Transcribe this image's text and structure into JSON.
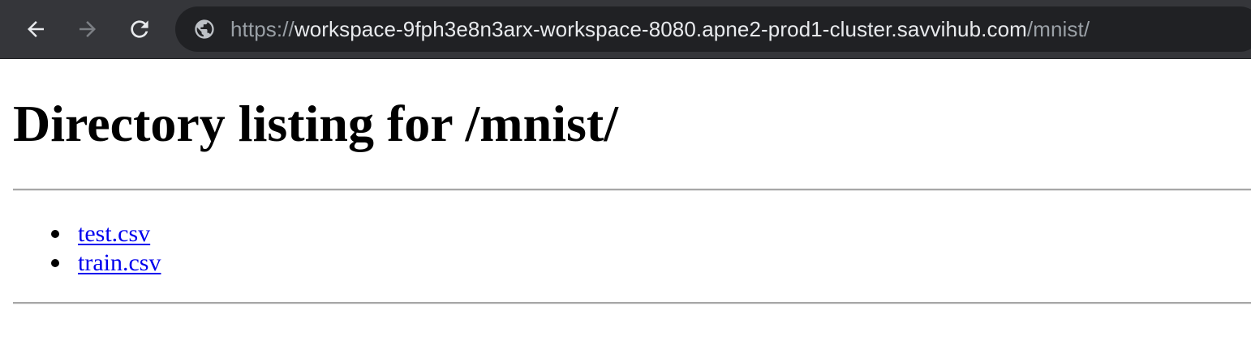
{
  "browser": {
    "url_scheme": "https://",
    "url_host": "workspace-9fph3e8n3arx-workspace-8080.apne2-prod1-cluster.savvihub.com",
    "url_path": "/mnist/",
    "icons": {
      "back": "arrow-left-icon",
      "forward": "arrow-right-icon",
      "reload": "reload-icon",
      "site": "globe-icon"
    },
    "colors": {
      "toolbar": "#35363a",
      "omnibox": "#202124",
      "url_host": "#e8eaed",
      "url_dim": "#9aa0a6",
      "forward_disabled": "#7c7f84"
    }
  },
  "page": {
    "title": "Directory listing for /mnist/",
    "files": [
      {
        "name": "test.csv"
      },
      {
        "name": "train.csv"
      }
    ],
    "colors": {
      "link": "#0000ee",
      "rule": "#a7a7a7"
    }
  }
}
